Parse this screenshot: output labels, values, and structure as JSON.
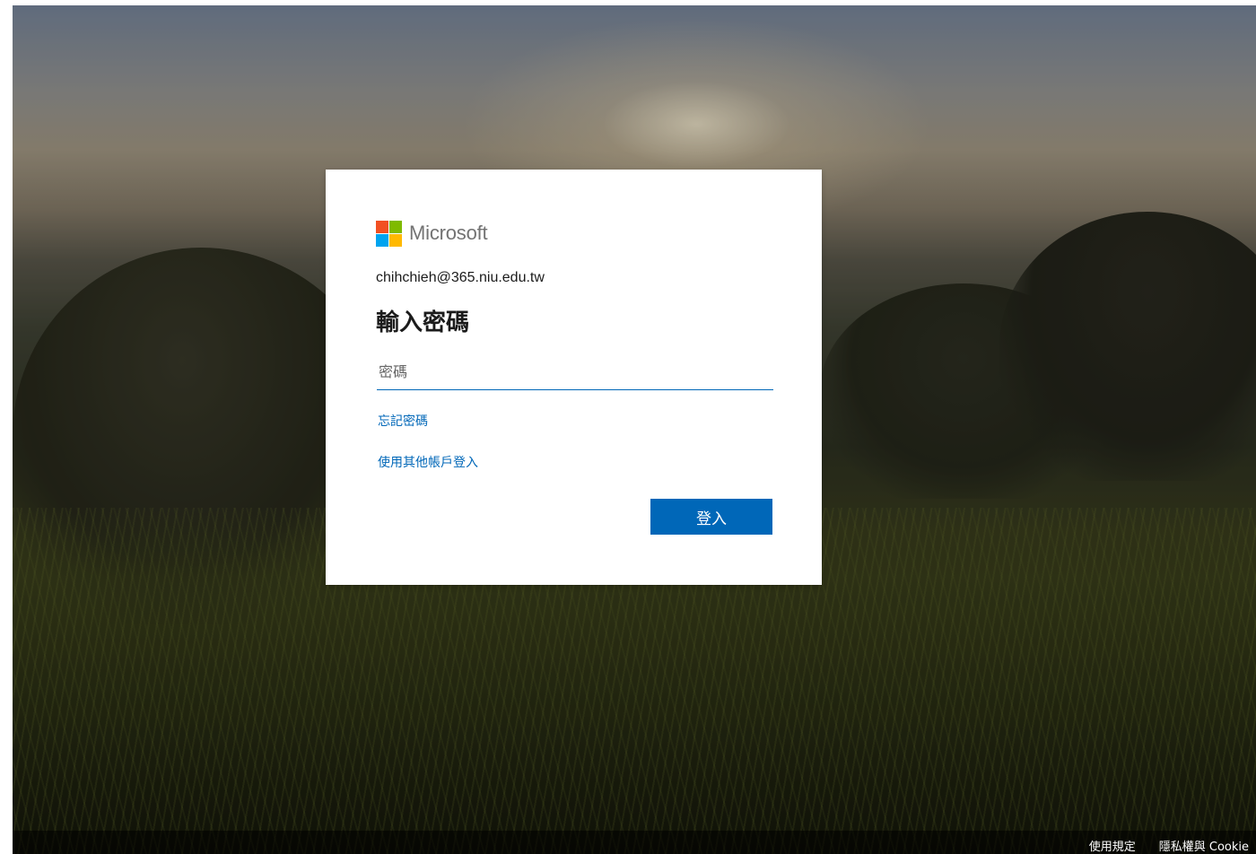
{
  "brand": {
    "name": "Microsoft",
    "logo_colors": [
      "#f25022",
      "#7fba00",
      "#00a4ef",
      "#ffb900"
    ]
  },
  "login": {
    "account_email": "chihchieh@365.niu.edu.tw",
    "heading": "輸入密碼",
    "password_placeholder": "密碼",
    "password_value": "",
    "forgot_password_link": "忘記密碼",
    "other_account_link": "使用其他帳戶登入",
    "sign_in_button": "登入",
    "accent_color": "#0067b8"
  },
  "footer": {
    "terms_link": "使用規定",
    "privacy_link": "隱私權與 Cookie"
  }
}
